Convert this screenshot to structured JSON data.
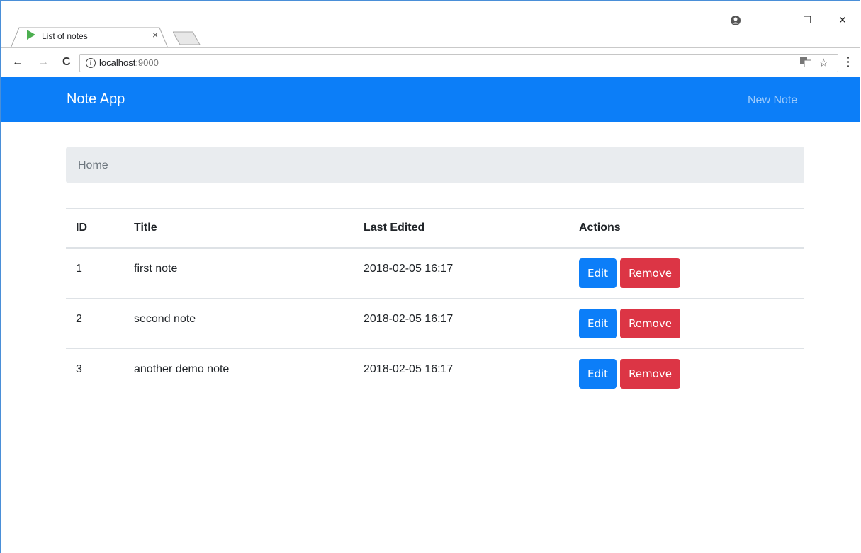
{
  "browser": {
    "tab_title": "List of notes",
    "tab_close": "×",
    "url_host": "localhost",
    "url_port": ":9000",
    "controls": {
      "minimize": "–",
      "maximize": "☐",
      "close": "✕"
    },
    "nav": {
      "back": "←",
      "forward": "→",
      "reload": "C"
    },
    "star": "☆"
  },
  "navbar": {
    "brand": "Note App",
    "new_note": "New Note",
    "color": "#0c7ef8"
  },
  "breadcrumb": {
    "home": "Home"
  },
  "table": {
    "headers": {
      "id": "ID",
      "title": "Title",
      "last_edited": "Last Edited",
      "actions": "Actions"
    },
    "rows": [
      {
        "id": "1",
        "title": "first note",
        "last_edited": "2018-02-05 16:17",
        "edit": "Edit",
        "remove": "Remove"
      },
      {
        "id": "2",
        "title": "second note",
        "last_edited": "2018-02-05 16:17",
        "edit": "Edit",
        "remove": "Remove"
      },
      {
        "id": "3",
        "title": "another demo note",
        "last_edited": "2018-02-05 16:17",
        "edit": "Edit",
        "remove": "Remove"
      }
    ]
  },
  "colors": {
    "edit": "#0c7ef8",
    "remove": "#dc3545"
  }
}
